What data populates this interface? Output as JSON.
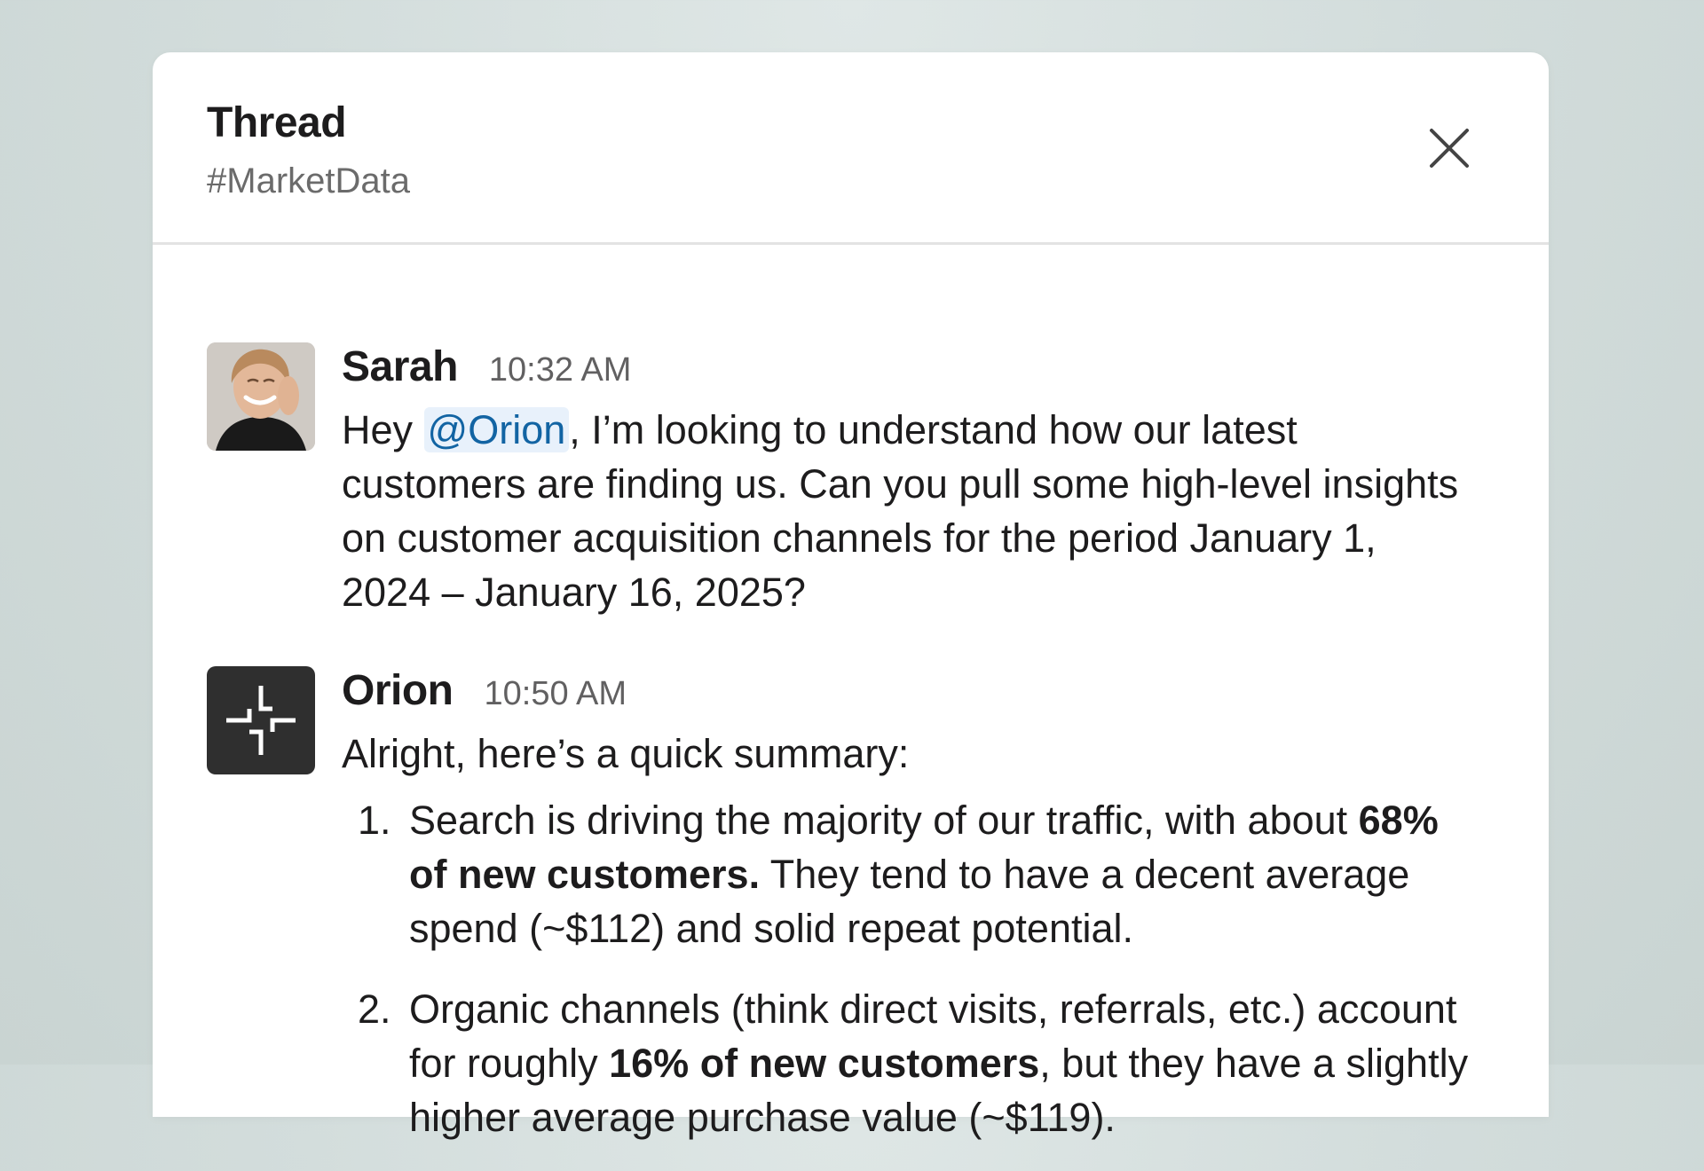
{
  "thread": {
    "title": "Thread",
    "channel": "#MarketData",
    "close_icon": "close-icon"
  },
  "messages": [
    {
      "author": "Sarah",
      "time": "10:32 AM",
      "avatar": "user-photo-avatar",
      "text_before": "Hey ",
      "mention": "@Orion",
      "text_after": ", I’m looking to understand how our latest customers are finding us. Can you pull some high-level insights on customer acquisition channels for the period January 1, 2024 – January 16, 2025?"
    },
    {
      "author": "Orion",
      "time": "10:50 AM",
      "avatar": "orion-logo-avatar",
      "intro": "Alright, here’s a quick summary:",
      "items": [
        {
          "num": "1.",
          "before": "Search is driving the majority of our traffic, with about ",
          "bold": "68% of new customers.",
          "after": " They tend to have a decent average spend (~$112) and solid repeat potential."
        },
        {
          "num": "2.",
          "before": "Organic channels (think direct visits, referrals, etc.) account for roughly ",
          "bold": "16% of new customers",
          "after": ", but they have a slightly higher average purchase value (~$119)."
        }
      ]
    }
  ],
  "colors": {
    "background": "#d3dddc",
    "panel": "#ffffff",
    "text": "#1d1c1d",
    "muted": "#6b6b6b",
    "mention_text": "#1264a3",
    "mention_bg": "#e8f1fb",
    "orion_avatar": "#2f2f2f"
  }
}
